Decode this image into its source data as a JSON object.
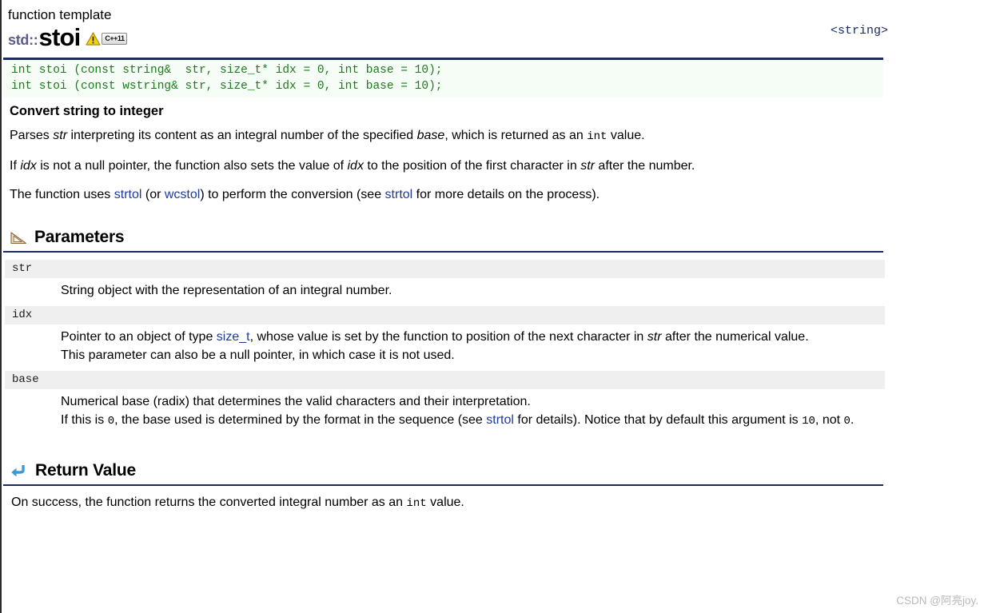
{
  "header": {
    "kind": "function template",
    "namespace": "std::",
    "function_name": "stoi",
    "badge_label": "C++11",
    "warning_icon": "warning-triangle-icon",
    "header_include": "<string>"
  },
  "signature": {
    "lines": [
      "int stoi (const string&  str, size_t* idx = 0, int base = 10);",
      "int stoi (const wstring& str, size_t* idx = 0, int base = 10);"
    ]
  },
  "description": {
    "subhead": "Convert string to integer",
    "p1": {
      "a": "Parses ",
      "str": "str",
      "b": " interpreting its content as an integral number of the specified ",
      "base": "base",
      "c": ", which is returned as an ",
      "int": "int",
      "d": " value."
    },
    "p2": {
      "a": "If ",
      "idx1": "idx",
      "b": " is not a null pointer, the function also sets the value of ",
      "idx2": "idx",
      "c": " to the position of the first character in ",
      "str": "str",
      "d": " after the number."
    },
    "p3": {
      "a": "The function uses ",
      "strtol1": "strtol",
      "b": " (or ",
      "wcstol": "wcstol",
      "c": ") to perform the conversion (see ",
      "strtol2": "strtol",
      "d": " for more details on the process)."
    }
  },
  "parameters_section": {
    "title": "Parameters",
    "icon": "ruler-triangle-icon",
    "items": [
      {
        "name": "str",
        "lines": [
          {
            "text": "String object with the representation of an integral number."
          }
        ]
      },
      {
        "name": "idx",
        "lines": [
          {
            "a": "Pointer to an object of type ",
            "link": "size_t",
            "b": ", whose value is set by the function to position of the next character in ",
            "em": "str",
            "c": " after the numerical value."
          },
          {
            "text": "This parameter can also be a null pointer, in which case it is not used."
          }
        ]
      },
      {
        "name": "base",
        "lines": [
          {
            "text": "Numerical base (radix) that determines the valid characters and their interpretation."
          },
          {
            "a": "If this is ",
            "code1": "0",
            "b": ", the base used is determined by the format in the sequence (see ",
            "link": "strtol",
            "c": " for details). Notice that by default this argument is ",
            "code2": "10",
            "d": ", not ",
            "code3": "0",
            "e": "."
          }
        ]
      }
    ]
  },
  "return_section": {
    "title": "Return Value",
    "icon": "return-arrow-icon",
    "body": {
      "a": "On success, the function returns the converted integral number as an ",
      "int": "int",
      "b": " value."
    }
  },
  "watermark": "CSDN @阿亮joy.",
  "colors": {
    "rule": "#1b2a63",
    "code_text": "#1f7a1f",
    "code_bg": "#f6fdf6",
    "link": "#1b3a9c",
    "namespace": "#5c5c8a",
    "param_band": "#efefef",
    "watermark": "#b9b9b9"
  }
}
